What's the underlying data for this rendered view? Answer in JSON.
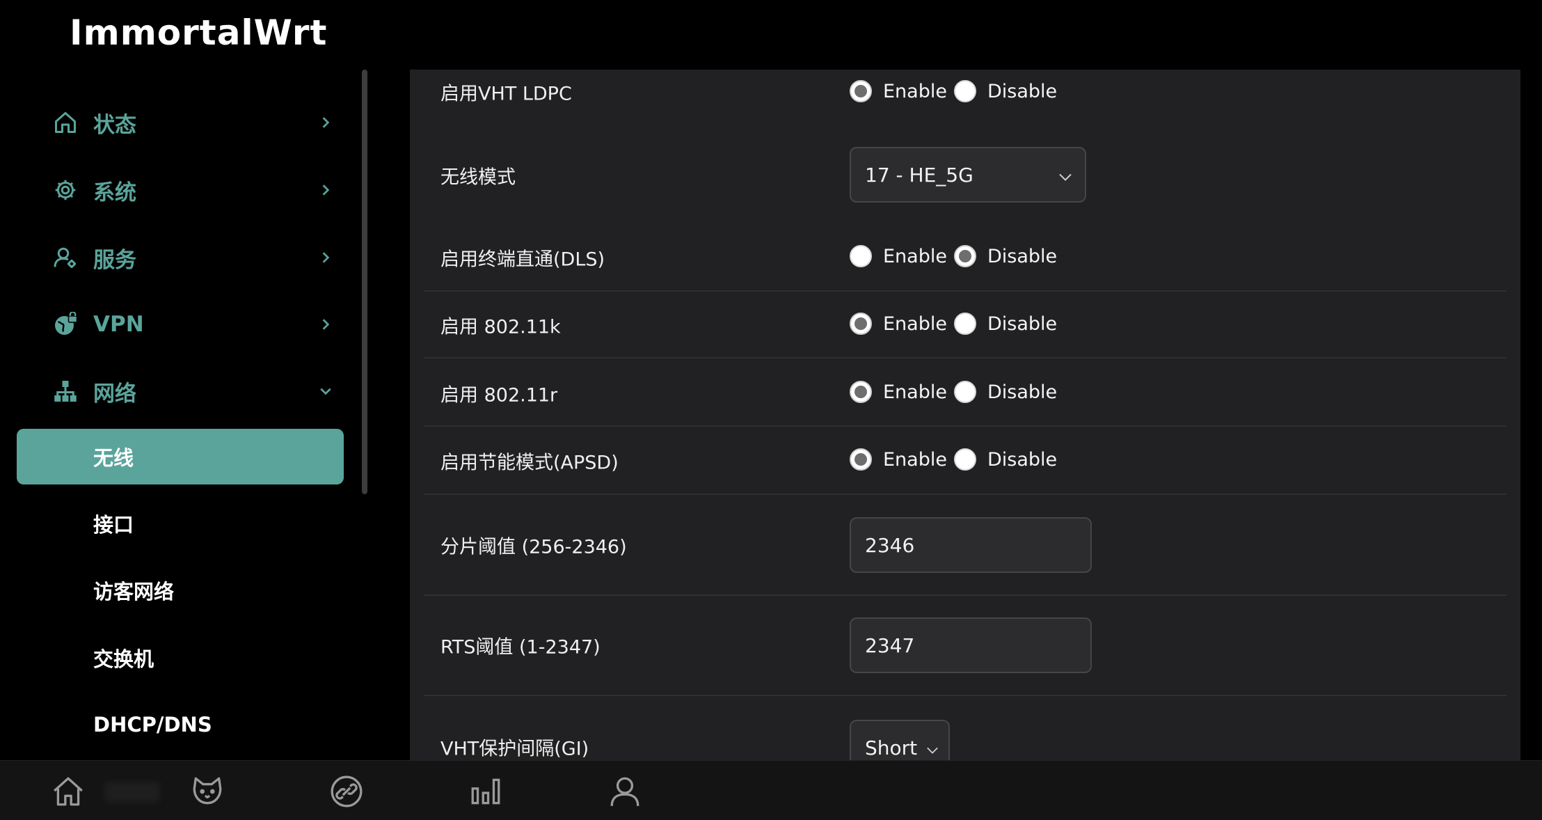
{
  "app": {
    "title": "ImmortalWrt"
  },
  "sidebar": {
    "items": [
      {
        "label": "状态",
        "icon": "home-icon",
        "state": "collapsed"
      },
      {
        "label": "系统",
        "icon": "gear-icon",
        "state": "collapsed"
      },
      {
        "label": "服务",
        "icon": "user-gear-icon",
        "state": "collapsed"
      },
      {
        "label": "VPN",
        "icon": "globe-lock-icon",
        "state": "collapsed"
      },
      {
        "label": "网络",
        "icon": "network-tree-icon",
        "state": "expanded"
      }
    ],
    "sub_items": [
      {
        "label": "无线",
        "active": true
      },
      {
        "label": "接口",
        "active": false
      },
      {
        "label": "访客网络",
        "active": false
      },
      {
        "label": "交换机",
        "active": false
      },
      {
        "label": "DHCP/DNS",
        "active": false
      }
    ]
  },
  "form": {
    "vht_ldpc": {
      "label": "启用VHT LDPC",
      "enable": "Enable",
      "disable": "Disable",
      "selected": "Enable"
    },
    "wireless_mode": {
      "label": "无线模式",
      "value": "17 - HE_5G"
    },
    "dls": {
      "label": "启用终端直通(DLS)",
      "enable": "Enable",
      "disable": "Disable",
      "selected": "Disable"
    },
    "k80211": {
      "label": "启用 802.11k",
      "enable": "Enable",
      "disable": "Disable",
      "selected": "Enable"
    },
    "r80211": {
      "label": "启用 802.11r",
      "enable": "Enable",
      "disable": "Disable",
      "selected": "Enable"
    },
    "apsd": {
      "label": "启用节能模式(APSD)",
      "enable": "Enable",
      "disable": "Disable",
      "selected": "Enable"
    },
    "frag": {
      "label": "分片阈值 (256-2346)",
      "value": "2346"
    },
    "rts": {
      "label": "RTS阈值 (1-2347)",
      "value": "2347"
    },
    "vht_gi": {
      "label": "VHT保护间隔(GI)",
      "value": "Short"
    }
  },
  "bottom_bar": {
    "icons": [
      "home-icon",
      "cat-icon",
      "link-icon",
      "bar-chart-icon",
      "user-icon"
    ]
  },
  "colors": {
    "accent": "#5aa49b",
    "panel": "#212123",
    "background": "#000000"
  }
}
